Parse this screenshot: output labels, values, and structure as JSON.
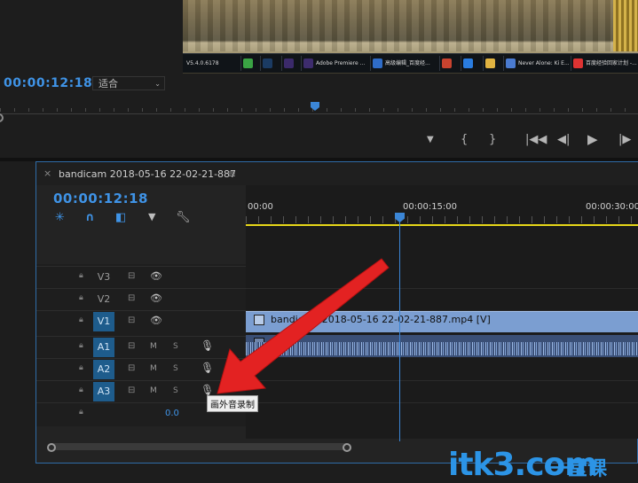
{
  "program_monitor": {
    "timecode": "00:00:12:18",
    "zoom_select": "适合",
    "taskbar_items": [
      {
        "label": "V5.4.0.6178",
        "icon": "app-icon",
        "color": "#3b3b3b"
      },
      {
        "label": "",
        "icon": "wechat-icon",
        "color": "#3aa344"
      },
      {
        "label": "",
        "icon": "photoshop-icon",
        "color": "#1b3b63"
      },
      {
        "label": "",
        "icon": "after-effects-icon",
        "color": "#3b2a6b"
      },
      {
        "label": "Adobe Premiere ...",
        "icon": "premiere-icon",
        "color": "#3d2c6d"
      },
      {
        "label": "高级编辑_百度经...",
        "icon": "editor-icon",
        "color": "#2f6cc7"
      },
      {
        "label": "",
        "icon": "app-icon",
        "color": "#c8432f"
      },
      {
        "label": "",
        "icon": "browser-icon",
        "color": "#2a7de1"
      },
      {
        "label": "",
        "icon": "folder-icon",
        "color": "#e0b341"
      },
      {
        "label": "Never Alone: Ki E...",
        "icon": "game-icon",
        "color": "#4a7bd1"
      },
      {
        "label": "百度经验回家计划 -...",
        "icon": "baidu-icon",
        "color": "#d33"
      }
    ],
    "transport": [
      "▼",
      "{",
      "}",
      "|◀◀",
      "◀|",
      "▶",
      "|▶"
    ]
  },
  "timeline": {
    "sequence_name": "bandicam 2018-05-16 22-02-21-887",
    "timecode": "00:00:12:18",
    "ruler_labels": [
      "00:00",
      "00:00:15:00",
      "00:00:30:00"
    ],
    "tracks": [
      {
        "name": "V3",
        "kind": "video",
        "active": false
      },
      {
        "name": "V2",
        "kind": "video",
        "active": false
      },
      {
        "name": "V1",
        "kind": "video",
        "active": true
      },
      {
        "name": "A1",
        "kind": "audio",
        "active": true
      },
      {
        "name": "A2",
        "kind": "audio",
        "active": true
      },
      {
        "name": "A3",
        "kind": "audio",
        "active": true
      }
    ],
    "mute_label": "M",
    "solo_label": "S",
    "master_value": "0.0",
    "video_clip_label": "bandicam 2018-05-16 22-02-21-887.mp4 [V]",
    "tooltip": "画外音录制"
  },
  "watermark": {
    "latin": "itk3.com",
    "chinese": "一堂课"
  }
}
